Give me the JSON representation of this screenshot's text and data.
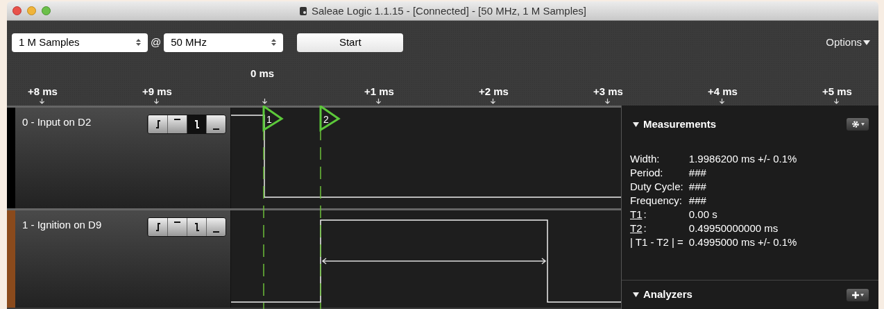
{
  "window": {
    "title": "Saleae Logic 1.1.15 - [Connected] - [50 MHz, 1 M Samples]"
  },
  "toolbar": {
    "samples": "1 M Samples",
    "at": "@",
    "rate": "50 MHz",
    "start": "Start",
    "options": "Options"
  },
  "ruler": {
    "origin": "0 ms",
    "ticks": [
      "+8 ms",
      "+9 ms",
      "+1 ms",
      "+2 ms",
      "+3 ms",
      "+4 ms",
      "+5 ms"
    ]
  },
  "channels": [
    {
      "name": "0 - Input on D2",
      "color": "#000000",
      "triggers": [
        {
          "kind": "rising",
          "selected": false
        },
        {
          "kind": "high",
          "selected": false
        },
        {
          "kind": "falling",
          "selected": true
        },
        {
          "kind": "low",
          "selected": false
        }
      ]
    },
    {
      "name": "1 - Ignition on D9",
      "color": "#8a4a1c",
      "triggers": [
        {
          "kind": "rising",
          "selected": false
        },
        {
          "kind": "high",
          "selected": false
        },
        {
          "kind": "falling",
          "selected": false
        },
        {
          "kind": "low",
          "selected": false
        }
      ]
    }
  ],
  "markers": [
    "1",
    "2"
  ],
  "measurements": {
    "title": "Measurements",
    "rows": [
      {
        "label": "Width:",
        "value": "1.9986200 ms +/- 0.1%",
        "link": false
      },
      {
        "label": "Period:",
        "value": "###",
        "link": false
      },
      {
        "label": "Duty Cycle:",
        "value": "###",
        "link": false
      },
      {
        "label": "Frequency:",
        "value": "###",
        "link": false
      },
      {
        "label": "T1",
        "suffix": ":",
        "value": "0.00 s",
        "link": true
      },
      {
        "label": "T2",
        "suffix": ":",
        "value": "0.49950000000 ms",
        "link": true
      },
      {
        "label": "| T1 - T2 | =",
        "value": "0.4995000 ms +/- 0.1%",
        "link": false
      }
    ]
  },
  "analyzers": {
    "title": "Analyzers"
  }
}
